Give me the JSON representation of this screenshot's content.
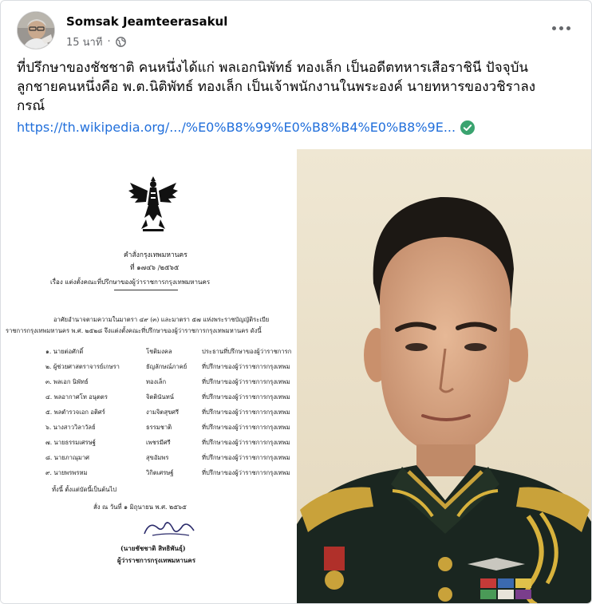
{
  "post": {
    "author": "Somsak Jeamteerasakul",
    "time": "15 นาที",
    "separator": "·",
    "text_lines": [
      "ที่ปรึกษาของชัชชาติ คนหนึ่งได้แก่ พลเอกนิพัทธ์ ทองเล็ก เป็นอดีตทหารเสือราชินี ปัจจุบัน",
      "ลูกชายคนหนึ่งคือ พ.ต.นิติพัทธ์ ทองเล็ก เป็นเจ้าพนักงานในพระองค์ นายทหารของวชิราลง",
      "กรณ์"
    ],
    "link": "https://th.wikipedia.org/.../%E0%B8%99%E0%B8%B4%E0%B8%9E..."
  },
  "document": {
    "heading": "คำสั่งกรุงเทพมหานคร",
    "number": "ที่ ๑๗๔๖ /๒๕๖๕",
    "subject": "เรื่อง  แต่งตั้งคณะที่ปรึกษาของผู้ว่าราชการกรุงเทพมหานคร",
    "para1": "อาศัยอำนาจตามความในมาตรา ๔๙ (๓) และมาตรา ๕๗ แห่งพระราชบัญญัติระเบีย",
    "para2": "ราชการกรุงเทพมหานคร พ.ศ. ๒๕๒๘ จึงแต่งตั้งคณะที่ปรึกษาของผู้ว่าราชการกรุงเทพมหานคร ดังนี้",
    "rows": [
      {
        "name": "๑. นายต่อศักดิ์",
        "surname": "โชติมงคล",
        "role": "ประธานที่ปรึกษาของผู้ว่าราชการก"
      },
      {
        "name": "๒. ผู้ช่วยศาสตราจารย์เกษรา",
        "surname": "ธัญลักษณ์ภาคย์",
        "role": "ที่ปรึกษาของผู้ว่าราชการกรุงเทพม"
      },
      {
        "name": "๓. พลเอก นิพัทธ์",
        "surname": "ทองเล็ก",
        "role": "ที่ปรึกษาของผู้ว่าราชการกรุงเทพม"
      },
      {
        "name": "๔. พลอากาศโท อนุตตร",
        "surname": "จิตตินันทน์",
        "role": "ที่ปรึกษาของผู้ว่าราชการกรุงเทพม"
      },
      {
        "name": "๕. พลตำรวจเอก อติศร์",
        "surname": "งามจิตสุขศรี",
        "role": "ที่ปรึกษาของผู้ว่าราชการกรุงเทพม"
      },
      {
        "name": "๖. นางสาววิลาวัลย์",
        "surname": "ธรรมชาติ",
        "role": "ที่ปรึกษาของผู้ว่าราชการกรุงเทพม"
      },
      {
        "name": "๗. นายธรรมเศรษฐ์",
        "surname": "เพชรมีศรี",
        "role": "ที่ปรึกษาของผู้ว่าราชการกรุงเทพม"
      },
      {
        "name": "๘. นายภาณุมาศ",
        "surname": "สุขอัมพร",
        "role": "ที่ปรึกษาของผู้ว่าราชการกรุงเทพม"
      },
      {
        "name": "๙. นายพรพรหม",
        "surname": "วิกิตเศรษฐ์",
        "role": "ที่ปรึกษาของผู้ว่าราชการกรุงเทพม"
      }
    ],
    "effective": "ทั้งนี้  ตั้งแต่บัดนี้เป็นต้นไป",
    "date": "สั่ง   ณ   วันที่  ๑  มิถุนายน  พ.ศ.  ๒๕๖๕",
    "signer": "(นายชัชชาติ  สิทธิพันธุ์)",
    "signer_title": "ผู้ว่าราชการกรุงเทพมหานคร"
  },
  "icons": {
    "globe": "globe-icon",
    "more": "more-options-icon",
    "verified_link": "check-circle-icon",
    "garuda": "garuda-emblem"
  },
  "colors": {
    "link": "#216fdb",
    "muted": "#65676b",
    "check": "#3aa36f",
    "uniform": "#1a2620"
  }
}
